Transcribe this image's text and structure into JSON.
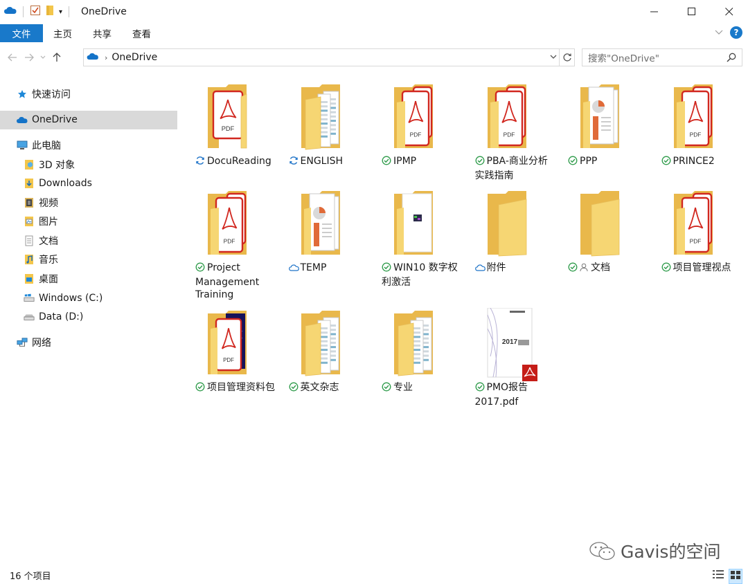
{
  "window": {
    "title": "OneDrive",
    "controls": {
      "minimize": "minimize-icon",
      "maximize": "maximize-icon",
      "close": "close-icon"
    }
  },
  "ribbon": {
    "tabs": [
      "文件",
      "主页",
      "共享",
      "查看"
    ],
    "help_label": "?"
  },
  "nav": {
    "address": "OneDrive",
    "search_placeholder": "搜索\"OneDrive\""
  },
  "sidebar": {
    "items": [
      {
        "label": "快速访问",
        "icon": "star-icon",
        "indent": 0
      },
      {
        "label": "OneDrive",
        "icon": "cloud-icon",
        "indent": 0,
        "selected": true
      },
      {
        "label": "此电脑",
        "icon": "computer-icon",
        "indent": 0
      },
      {
        "label": "3D 对象",
        "icon": "3d-objects-icon",
        "indent": 1
      },
      {
        "label": "Downloads",
        "icon": "download-folder-icon",
        "indent": 1
      },
      {
        "label": "视频",
        "icon": "video-folder-icon",
        "indent": 1
      },
      {
        "label": "图片",
        "icon": "pictures-folder-icon",
        "indent": 1
      },
      {
        "label": "文档",
        "icon": "documents-folder-icon",
        "indent": 1
      },
      {
        "label": "音乐",
        "icon": "music-folder-icon",
        "indent": 1
      },
      {
        "label": "桌面",
        "icon": "desktop-folder-icon",
        "indent": 1
      },
      {
        "label": "Windows (C:)",
        "icon": "windows-drive-icon",
        "indent": 1
      },
      {
        "label": "Data (D:)",
        "icon": "drive-icon",
        "indent": 1
      },
      {
        "label": "网络",
        "icon": "network-icon",
        "indent": 0
      }
    ]
  },
  "items": [
    {
      "name": "DocuReading",
      "status": "sync",
      "thumb": "pdf"
    },
    {
      "name": "ENGLISH",
      "status": "sync",
      "thumb": "docs"
    },
    {
      "name": "IPMP",
      "status": "ok",
      "thumb": "pdf2"
    },
    {
      "name": "PBA-商业分析实践指南",
      "status": "ok",
      "thumb": "pdf2"
    },
    {
      "name": "PPP",
      "status": "ok",
      "thumb": "ppt"
    },
    {
      "name": "PRINCE2",
      "status": "ok",
      "thumb": "pdf2"
    },
    {
      "name": "Project Management Training",
      "status": "ok",
      "thumb": "pdf2"
    },
    {
      "name": "TEMP",
      "status": "cloud",
      "thumb": "ppt"
    },
    {
      "name": "WIN10 数字权利激活",
      "status": "ok",
      "thumb": "win"
    },
    {
      "name": "附件",
      "status": "cloud",
      "thumb": "empty"
    },
    {
      "name": "文档",
      "status": "ok-shared",
      "thumb": "empty"
    },
    {
      "name": "项目管理视点",
      "status": "ok",
      "thumb": "pdf2"
    },
    {
      "name": "项目管理资料包",
      "status": "ok",
      "thumb": "pdfbook"
    },
    {
      "name": "英文杂志",
      "status": "ok",
      "thumb": "docs"
    },
    {
      "name": "专业",
      "status": "ok",
      "thumb": "docs"
    },
    {
      "name": "PMO报告2017.pdf",
      "status": "ok",
      "thumb": "pmofile"
    }
  ],
  "status": {
    "count": "16 个项目"
  },
  "watermark": "Gavis的空间",
  "pdf_label": "PDF",
  "pmo_thumb_text": "2017"
}
